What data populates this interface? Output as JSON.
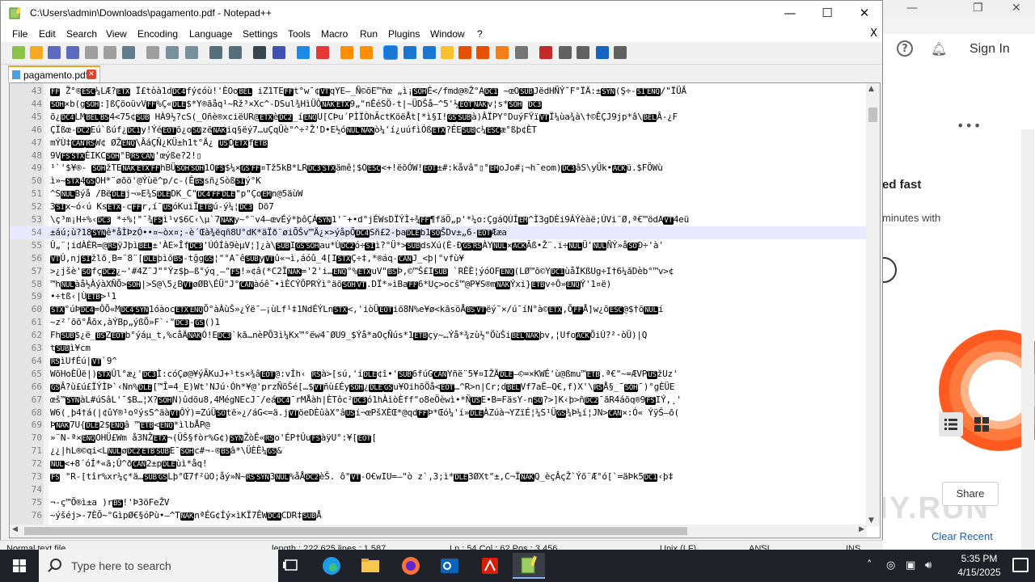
{
  "window": {
    "title": "C:\\Users\\admin\\Downloads\\pagamento.pdf - Notepad++",
    "minimize": "—",
    "maximize": "☐",
    "close": "✕"
  },
  "menu": [
    "File",
    "Edit",
    "Search",
    "View",
    "Encoding",
    "Language",
    "Settings",
    "Tools",
    "Macro",
    "Run",
    "Plugins",
    "Window",
    "?"
  ],
  "menu_close": "X",
  "toolbar_icons": [
    "new-file-icon",
    "open-file-icon",
    "save-icon",
    "save-all-icon",
    "close-icon",
    "close-all-icon",
    "print-icon",
    "cut-icon",
    "copy-icon",
    "paste-icon",
    "undo-icon",
    "redo-icon",
    "find-icon",
    "replace-icon",
    "zoom-in-icon",
    "zoom-out-icon",
    "sync-v-icon",
    "sync-h-icon",
    "word-wrap-icon",
    "show-all-chars-icon",
    "indent-guide-icon",
    "udl-icon",
    "doc-map-icon",
    "function-list-icon",
    "folder-workspace-icon",
    "monitoring-icon",
    "record-macro-icon",
    "stop-macro-icon",
    "play-macro-icon",
    "run-macro-multiple-icon",
    "save-macro-icon"
  ],
  "tab": {
    "label": "pagamento.pdf",
    "close": "✕"
  },
  "editor": {
    "current_line": 54,
    "lines": [
      {
        "n": "43",
        "t": "FF Ž°®ESC¼LÆ?ETX Ï£tòà1dDC4fý¢óù!'ÈOoBEL iZ1TEFFt°w¯¢VTqYE–_Ñ©õE™ñœ „ì¡SOHÉ</fmd@®Ž°ADC1 ~œOSUBJëdHÑÝ˜F°ÏÄ:±SYN(Ş÷-SIENQ/\"ÏÜÂ"
      },
      {
        "n": "44",
        "t": "SOH×b(gSOH:]ßÇõoüvVFF%Ç«DLE$*Y®ãåq¹~Rž³×Xc^-DSul¾HìÜÔNAKETX9„\"nÊéSÖ-t|~ÜDŠå–^5'½EOTNAKv¦s*SOH DC3"
      },
      {
        "n": "45",
        "t": "õ¿DC4LMBELBS4<75¢SUB HÀ9½?cS(_Oñè®xciëUR@ETXèDC2_íENQU[CÞu´PÌÏÒhÃctKöëÅt[*ì§I!GSSUBà)ÂÏPY°DuýFŸïVTÏ¼ùa¾à\\†©ÊÇJ9jp*â\\BELÂ-¿F"
      },
      {
        "n": "46",
        "t": "ÇÏßœ-DC2Eú`ßúf¿DC1y!ÝéEOTõ¿oSOzëNAKiq§ëý7…uÇqÜè°^÷²Ž'D•E½óNULNAKò¼'í¿uúfìÓßETX?ÉESUBc¼ESCæ°ßþ¢ÈT"
      },
      {
        "n": "47",
        "t": "mÝÙ‡CANRSW¢ ØŽENQ\\ÂáÇÑ¿KÜ±h1t°Ä¿ USDETXfETB"
      },
      {
        "n": "48",
        "t": "9VFSSTXÈIKCSOH°BRSCAN'œýße?2!▯"
      },
      {
        "n": "49",
        "t": "¹`'$¥®- SOHžTENAKETXFFhBÜSOHSOH1OFS$¼×GSFF¤Tž5kB*LRDC3STXämê¦$OESC<+!ëõÓW!EOT±#:kåvâ\"▯°EMoJo#¡¬h¯eom)DC3âS\\yÜk•ACKü.$FÖWù"
      },
      {
        "n": "50",
        "t": "ì»~STX4GSOH*¨øõö'@Ýùë^p/c-(ÊBSsñ¿SòßSIý°K"
      },
      {
        "n": "51",
        "t": "^SNULBýå /BëDLEj¬»E¾SDLEDK_C\"DC4FFDLE\"p\"ÇoEMn@5äùW"
      },
      {
        "n": "52",
        "t": "3SIx~ó‹ú KsETX-cFFr,í¯USóKuiÏETBú-ý¼¦DC3 Dõ7"
      },
      {
        "n": "53",
        "t": "\\ç³m¡H÷%‹DC3 *÷%¦\"¯¾FSì¹v$6C‹\\µ`7NAKy~°¨v4–œvÉý*þôÇÁSYN1'¯+•d°jÉWsDÏÝÌ÷¾FF¶fäÖ„p'*¼o:ÇgáQÚÍEM^Ì3gDÈi9ÁÝèàë;ÚVi¨Ø,ª€™ödAVT4eü"
      },
      {
        "n": "54",
        "t": "±áú;ù?18SYNê*åÌÞzÓ••¤~òx¤;-è´Œà¾ëqñ8U°dK*äÏð¨øiÕŠv™Ä¿×>ýåpÕDC4Sñ£2-þaDLEb1SOŠDv±„6-EOTÆæa"
      },
      {
        "n": "55",
        "t": "Û„¨¦idÀÈR=@RSÿJþìBEL±'ÀE»ÎfDC3'ÚÓÍà9èµV¦]¿à\\SUBIGSSOHau*ÙDC2ó÷SIì?°Ü*>SUBdsXú(È-ÐGSRSÀYNUL×ACKÃß•Ž¨.i÷NULÜ'NULÑÝ»åSOÐ÷'à'"
      },
      {
        "n": "56",
        "t": "VTÚ,njSIžlõ¸B=¨8¨[DLEþìõBS-tğgGS¦\"°A¯êSUByVTû«¬ì,áóû_4[ISTXÇ÷‡,*®áq-CANJ_<þ|°vfù¥"
      },
      {
        "n": "57",
        "t": ">¿jšè'SOfçDC2¿~'#4Z¯J\"°Ýz$þ–ß°ýq¸–\"FS!»¢â(*C2ÏNAK='2'i…ENQ°%ETXuV\"BSÞ,©™Š£ISUB `RÈÈ¦ýóOFENQ(LØ™õ©YDC1ùåÏKßUg÷I†6¼ãDèb°™v>¢"
      },
      {
        "n": "58",
        "t": "™hNULàå½ÀýàXÑÕ>SOH|>S@\\5¿BVTøØB\\ÉÜ\"J°CANàóê¯•ìÈCÝÕPRÝì°äõSOHVT.DÏ*»ìBaFF6*Uç>ocš™@P¥S®mNAKÝxi}ETBv÷Ô»ENQÝ'1¤ë)"
      },
      {
        "n": "59",
        "t": "•÷tß‹|ÙETB>¹1"
      },
      {
        "n": "60",
        "t": "STX°úÞDC4=ÔÕ«MDC4SYN1óàocETXENQÕ°àÀùŠ»¿Ýë¯—¡ùLf¹‡1NdÉÝLnSTX<,'iòÜEOTiõ8N%e¥ø<kãsöÅBSVTëý¯×/ú¯íN°à©ETX,ÕFFÅ]w¿õESC@$†õNULí"
      },
      {
        "n": "61",
        "t": "~z²´õõ°Åõx,àÝBp„ýßÕ»F`·\"DC3-GS()1"
      },
      {
        "n": "62",
        "t": "FhSUB$¿ë_BSZEOTb°ýáµ_t,%cåÄNAKÓ!EDC3`kã…nèPÕ3ì¼Kx™°ëw4¯ØU9_$Ýå*aOçÑús*1ETBçy~…Ýå*¾zù½\"ÖùŠiBELNAKþv,¦UfoACKÕiÚ?²·òÜ)|Q"
      },
      {
        "n": "63",
        "t": "tSUBì¥cm"
      },
      {
        "n": "64",
        "t": "RSìUfÉú|VT`9^"
      },
      {
        "n": "65",
        "t": "WõHoÈÜë|)STXÛl°æ¿'DC3Ì:cóÇø@¥ýÃKuJ+¹ts×¾âEOT@:vÍh‹ RSà>[sú,'íDLE¢î•'SUB6fúGCANYñë¨5¥¤IŽÄDLE—©=×KWÉ'ù@ßmu™ETB.ª€\"~=ÆVPUSžUz'"
      },
      {
        "n": "66",
        "t": "GSÂ?ù£ú£ÏÝÌÞ`‹Nn%DLE[™Î=4_E)Wt'NJú·Óh*¥@'przÑöŠé[…$VTñù£ÉySOH¿DLEGSu¥OihõÖå<EOT…^R>n|Cr;dBELVf7aË—Q€,f)X'\\RSÅ§_¯SOH¯)°gÈÜE"
      },
      {
        "n": "67",
        "t": "œš™SYNàL#úSâL'¯$B…¦X?SOHN)ûdõu8,4MégNEcJ¯/eáDC4¯rMÅàh|ÈTôc²DC3ó1hÀìòÈff\"o8eÖèwì•*ÑUSE•B=FäsY-nSO?>]K‹þ>ñDC2¯ãR4áõq®9FSIÝ,¸'"
      },
      {
        "n": "68",
        "t": "W6(¸þ4†á(|¢ûY®¹oºýsS^äàVTÔÝ)=ZúÜSOtë»¿/áG<=ä.jVTöeDÈûàX°âUSí¬œPšXÈŒ*@qdFFÞ*Œó¼'í»DLEÀZúà¬YZïÉ¦¼S¹ÜGS¾Þ¼í¦JN>CAN×:Ó«    ÝÿŠ–õ("
      },
      {
        "n": "69",
        "t": "ÞNAK7U{DLE2$ENQâ ™ETB<ENQ*ìlbÅP@"
      },
      {
        "n": "70",
        "t": "»¨N-ª×ENQOHÜ£Wm å3NŽETX¬(ÜŠ§fòr%G¢)SYNŽòÊ«RSo'ÉP†ÛuFSàÿU°:¥[EOT["
      },
      {
        "n": "71",
        "t": "¿¿|hL®©qi<LNULøDC2ETBSUBE¯SOHc#¬-®BSâ*\\ÜÈÊ¼GS&"
      },
      {
        "n": "72",
        "t": "NUL<+8´óÍ*«ã;Û^ðCAN2±pDLEùì*åq!"
      },
      {
        "n": "73",
        "t": "FS \"R-[tîr%xr¼ç*ä…SUBGSLþ°Œ7f²üO;åý»N~RSSYN3NUL%åÅDC2èŠ. ô\"VT-O€wIU=—\"ò z`,3;ì*DLE3ØXt\"±,C¬ÏNAKQ_èçÂçŽ`Ýõ¨Æ°ó[`=äÞk5DC1‹þ‡"
      },
      {
        "n": "74",
        "t": ""
      },
      {
        "n": "75",
        "t": "¬-ç™Õ®ì±a   )rBS!'Þ3öFeŽV"
      },
      {
        "n": "76",
        "t": "~ýšéj>-7ÈÕ~°GìpØ€§óPù•—^TNAKnªÉG¢Íý×ìKÏ7ÊWDC4CDR‡SUBÅ"
      }
    ]
  },
  "status": {
    "type": "Normal text file",
    "length": "length : 222,625   lines : 1,587",
    "position": "Ln : 54   Col : 62   Pos : 3,456",
    "eol": "Unix (LF)",
    "encoding": "ANSI",
    "mode": "INS"
  },
  "browser": {
    "sign_in": "Sign In",
    "promo_title": "ed fast",
    "promo_sub": "minutes with",
    "share": "Share",
    "clear_recent": "Clear Recent",
    "watermark": "ANY.RUN"
  },
  "taskbar": {
    "search_placeholder": "Type here to search",
    "time": "5:35 PM",
    "date": "4/15/2025",
    "apps": [
      "task-view-icon",
      "edge-icon",
      "file-explorer-icon",
      "firefox-icon",
      "outlook-icon",
      "acrobat-icon",
      "notepadpp-icon"
    ]
  },
  "colors": {
    "control_char_bg": "#000000",
    "control_char_fg": "#ffffff",
    "current_line": "#e8e8ff",
    "taskbar": "#1f2329"
  }
}
